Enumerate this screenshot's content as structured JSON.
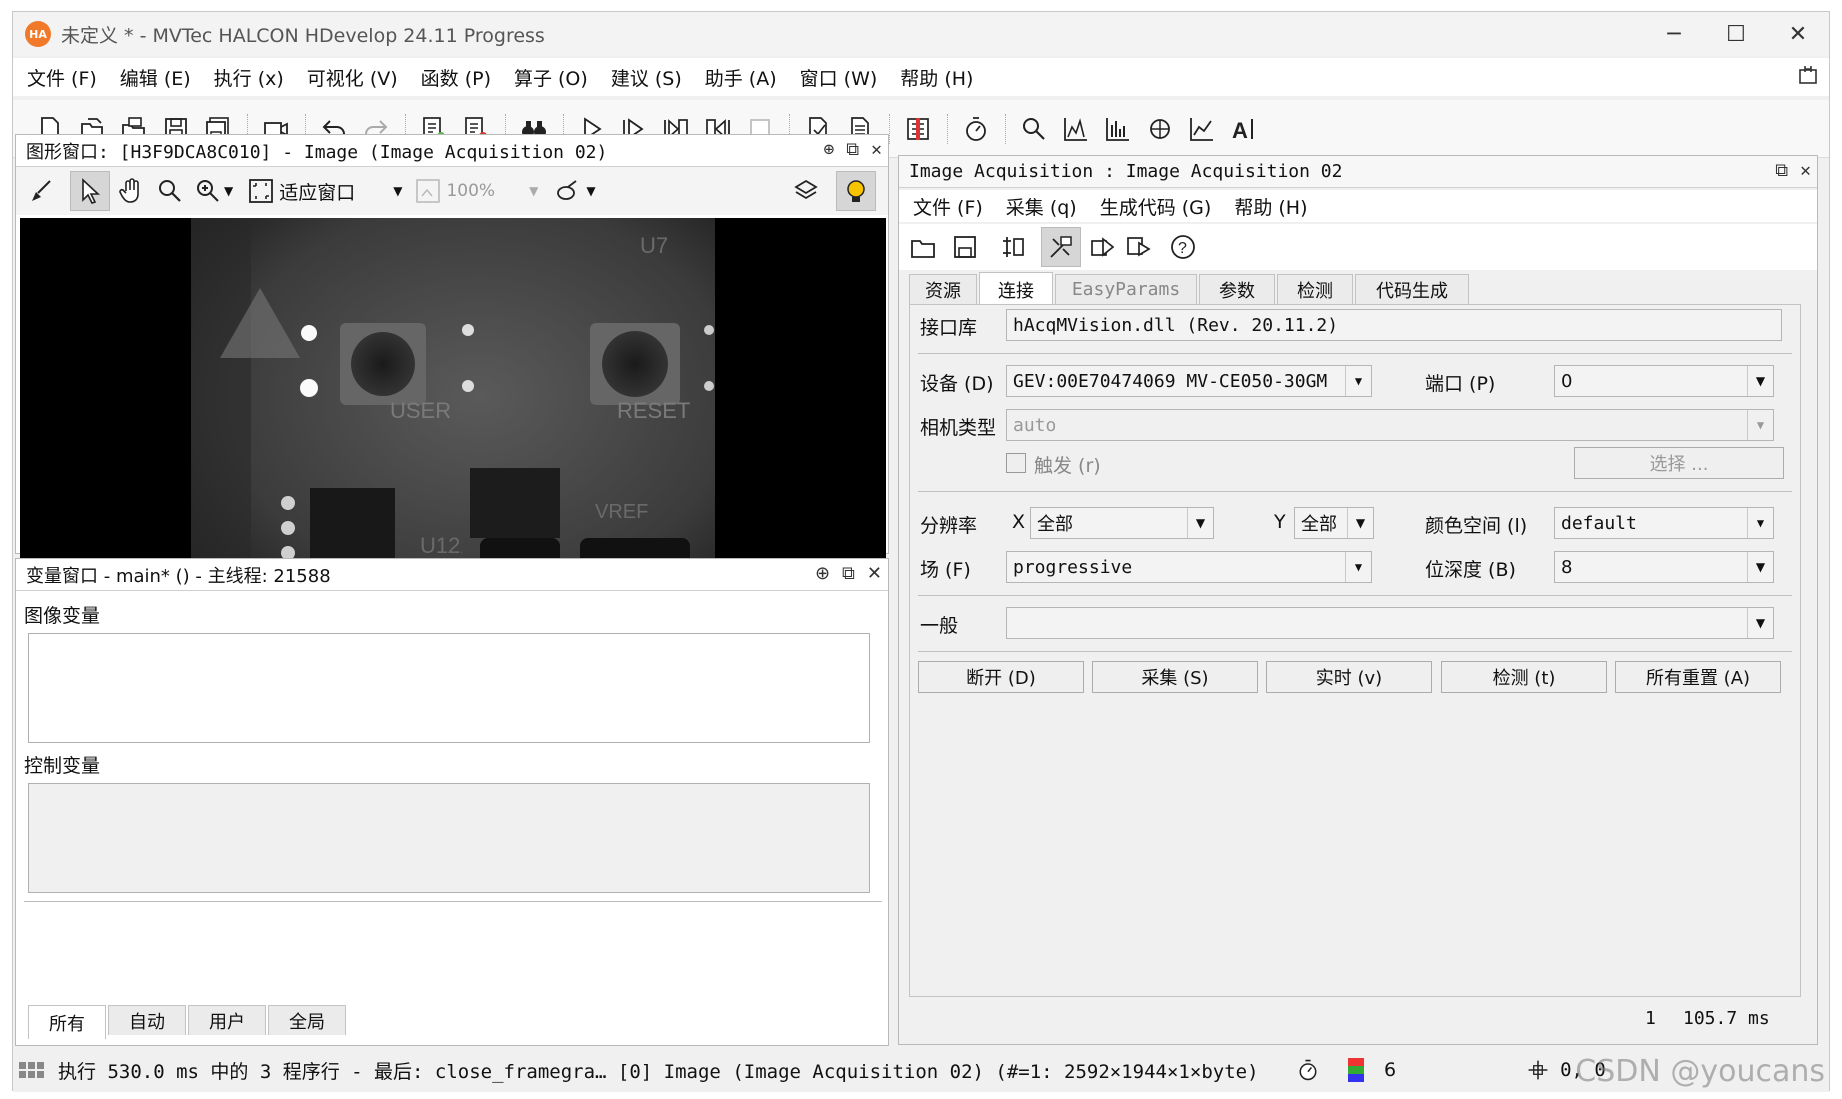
{
  "window": {
    "title": "未定义 * - MVTec HALCON HDevelop 24.11 Progress",
    "logo": "HA",
    "min": "─",
    "max": "☐",
    "close": "✕"
  },
  "menu": [
    "文件 (F)",
    "编辑 (E)",
    "执行 (x)",
    "可视化 (V)",
    "函数 (P)",
    "算子 (O)",
    "建议 (S)",
    "助手 (A)",
    "窗口 (W)",
    "帮助 (H)"
  ],
  "graphics": {
    "header": "图形窗口: [H3F9DCA8C010] - Image (Image Acquisition 02)",
    "fit_label": "适应窗口",
    "zoom": "100%"
  },
  "variables": {
    "header": "变量窗口 - main* () - 主线程: 21588",
    "iconic_label": "图像变量",
    "control_label": "控制变量",
    "tabs": [
      "所有",
      "自动",
      "用户",
      "全局"
    ]
  },
  "acq": {
    "header": "Image Acquisition : Image Acquisition 02",
    "menu": [
      "文件 (F)",
      "采集 (q)",
      "生成代码 (G)",
      "帮助 (H)"
    ],
    "tabs": [
      "资源",
      "连接",
      "EasyParams",
      "参数",
      "检测",
      "代码生成"
    ],
    "interface_label": "接口库",
    "interface_value": "hAcqMVision.dll (Rev. 20.11.2)",
    "device_label": "设备 (D)",
    "device_value": "GEV:00E70474069 MV-CE050-30GM",
    "port_label": "端口 (P)",
    "port_value": "0",
    "camtype_label": "相机类型",
    "camtype_value": "auto",
    "trigger_label": "触发 (r)",
    "select_label": "选择 ...",
    "res_label": "分辨率",
    "res_x_label": "X",
    "res_x_value": "全部",
    "res_y_label": "Y",
    "res_y_value": "全部",
    "color_label": "颜色空间 (l)",
    "color_value": "default",
    "field_label": "场 (F)",
    "field_value": "progressive",
    "depth_label": "位深度 (B)",
    "depth_value": "8",
    "general_label": "一般",
    "general_value": "",
    "buttons": [
      "断开 (D)",
      "采集 (S)",
      "实时 (v)",
      "检测 (t)",
      "所有重置 (A)"
    ],
    "status_count": "1",
    "status_time": "105.7 ms"
  },
  "status": {
    "text": "执行 530.0 ms 中的 3 程序行 - 最后: close_framegra… [0] Image (Image Acquisition 02) (#=1: 2592×1944×1×byte)",
    "count": "6",
    "coords": "0, 0",
    "watermark": "CSDN @youcans"
  }
}
